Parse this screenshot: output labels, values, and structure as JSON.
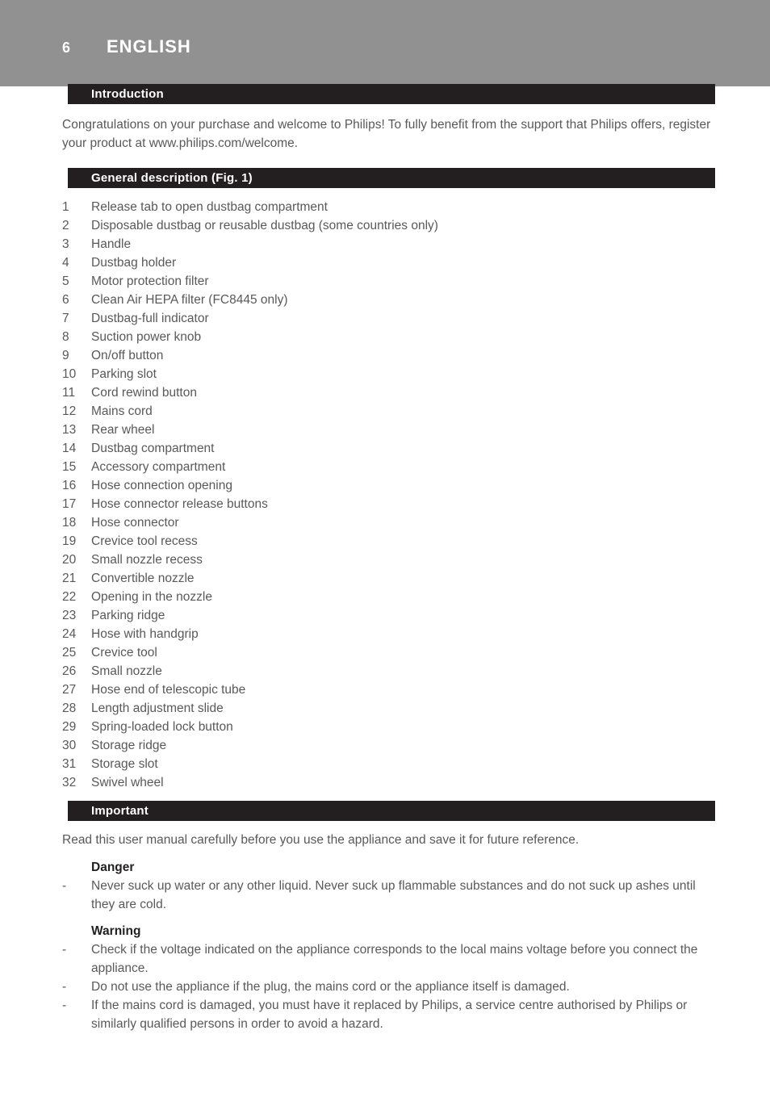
{
  "page": {
    "number": "6",
    "language": "ENGLISH",
    "band_color": "#919191",
    "bar_color": "#231f20",
    "text_color": "#595959"
  },
  "sections": {
    "introduction": {
      "heading": "Introduction",
      "body": "Congratulations on your purchase and welcome to Philips! To fully benefit from the support that Philips offers, register your product at www.philips.com/welcome."
    },
    "general_description": {
      "heading": "General description (Fig. 1)",
      "items": [
        {
          "num": "1",
          "label": "Release tab to open dustbag compartment"
        },
        {
          "num": "2",
          "label": "Disposable dustbag or reusable dustbag (some countries only)"
        },
        {
          "num": "3",
          "label": "Handle"
        },
        {
          "num": "4",
          "label": "Dustbag holder"
        },
        {
          "num": "5",
          "label": "Motor protection filter"
        },
        {
          "num": "6",
          "label": "Clean Air HEPA filter (FC8445 only)"
        },
        {
          "num": "7",
          "label": "Dustbag-full indicator"
        },
        {
          "num": "8",
          "label": "Suction power knob"
        },
        {
          "num": "9",
          "label": "On/off button"
        },
        {
          "num": "10",
          "label": "Parking slot"
        },
        {
          "num": "11",
          "label": "Cord rewind button"
        },
        {
          "num": "12",
          "label": "Mains cord"
        },
        {
          "num": "13",
          "label": "Rear wheel"
        },
        {
          "num": "14",
          "label": "Dustbag compartment"
        },
        {
          "num": "15",
          "label": "Accessory compartment"
        },
        {
          "num": "16",
          "label": "Hose connection opening"
        },
        {
          "num": "17",
          "label": "Hose connector release buttons"
        },
        {
          "num": "18",
          "label": "Hose connector"
        },
        {
          "num": "19",
          "label": "Crevice tool recess"
        },
        {
          "num": "20",
          "label": "Small nozzle recess"
        },
        {
          "num": "21",
          "label": "Convertible nozzle"
        },
        {
          "num": "22",
          "label": "Opening in the nozzle"
        },
        {
          "num": "23",
          "label": "Parking ridge"
        },
        {
          "num": "24",
          "label": "Hose with handgrip"
        },
        {
          "num": "25",
          "label": "Crevice tool"
        },
        {
          "num": "26",
          "label": "Small nozzle"
        },
        {
          "num": "27",
          "label": "Hose end of telescopic tube"
        },
        {
          "num": "28",
          "label": "Length adjustment slide"
        },
        {
          "num": "29",
          "label": "Spring-loaded lock button"
        },
        {
          "num": "30",
          "label": "Storage ridge"
        },
        {
          "num": "31",
          "label": "Storage slot"
        },
        {
          "num": "32",
          "label": "Swivel wheel"
        }
      ]
    },
    "important": {
      "heading": "Important",
      "body": "Read this user manual carefully before you use the appliance and save it for future reference.",
      "danger": {
        "heading": "Danger",
        "dash": "-",
        "bullets": [
          "Never suck up water or any other liquid. Never suck up flammable substances and do not suck up ashes until they are cold."
        ]
      },
      "warning": {
        "heading": "Warning",
        "dash": "-",
        "bullets": [
          "Check if the voltage indicated on the appliance corresponds to the local mains voltage before you connect the appliance.",
          "Do not use the appliance if the plug, the mains cord or the appliance itself is damaged.",
          "If the mains cord is damaged, you must have it replaced by Philips, a service centre authorised by Philips or similarly qualified persons in order to avoid a hazard."
        ]
      }
    }
  }
}
